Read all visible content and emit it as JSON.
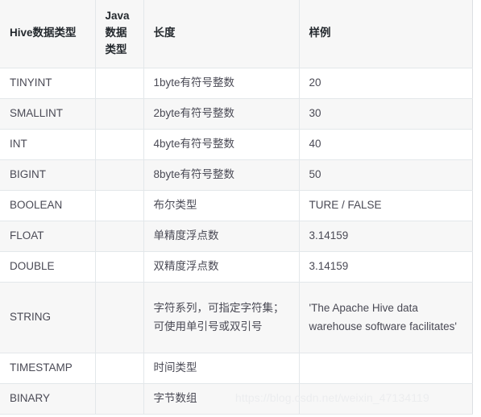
{
  "table": {
    "headers": [
      "Hive数据类型",
      "Java数据类型",
      "长度",
      "样例"
    ],
    "rows": [
      {
        "hive_type": "TINYINT",
        "java_type": "",
        "length": "1byte有符号整数",
        "sample": "20"
      },
      {
        "hive_type": "SMALLINT",
        "java_type": "",
        "length": "2byte有符号整数",
        "sample": "30"
      },
      {
        "hive_type": "INT",
        "java_type": "",
        "length": "4byte有符号整数",
        "sample": "40"
      },
      {
        "hive_type": "BIGINT",
        "java_type": "",
        "length": "8byte有符号整数",
        "sample": "50"
      },
      {
        "hive_type": "BOOLEAN",
        "java_type": "",
        "length": "布尔类型",
        "sample": "TURE / FALSE"
      },
      {
        "hive_type": "FLOAT",
        "java_type": "",
        "length": "单精度浮点数",
        "sample": "3.14159"
      },
      {
        "hive_type": "DOUBLE",
        "java_type": "",
        "length": "双精度浮点数",
        "sample": "3.14159"
      },
      {
        "hive_type": "STRING",
        "java_type": "",
        "length": "字符系列，可指定字符集；可使用单引号或双引号",
        "sample": "'The Apache Hive data warehouse software facilitates'"
      },
      {
        "hive_type": "TIMESTAMP",
        "java_type": "",
        "length": "时间类型",
        "sample": ""
      },
      {
        "hive_type": "BINARY",
        "java_type": "",
        "length": "字节数组",
        "sample": ""
      }
    ]
  },
  "watermark": {
    "text": "https://blog.csdn.net/weixin_47134119"
  },
  "colors": {
    "header_bg": "#f7f7f7",
    "alt_row_bg": "#f7f7f7",
    "row_bg": "#ffffff",
    "border": "#e3e7ea",
    "header_text": "#24292e",
    "body_text": "#4a4a55",
    "watermark_text": "#ecedef"
  }
}
